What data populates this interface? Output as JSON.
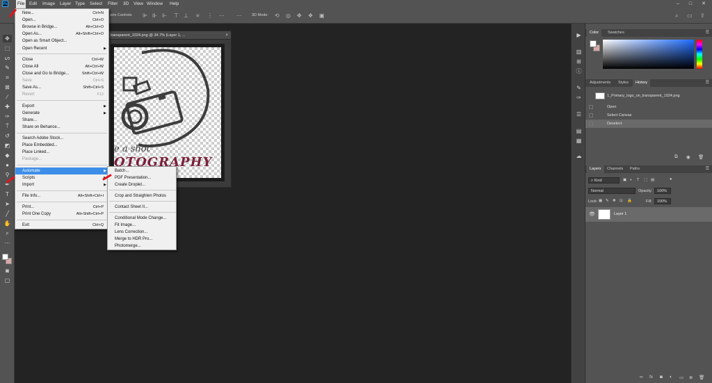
{
  "menubar": {
    "logo": "Ps",
    "items": [
      "File",
      "Edit",
      "Image",
      "Layer",
      "Type",
      "Select",
      "Filter",
      "3D",
      "View",
      "Window",
      "Help"
    ],
    "window_controls": [
      "–",
      "□",
      "✕"
    ]
  },
  "options_bar": {
    "transform_controls_label": "orm Controls",
    "mode_3d_label": "3D Mode:"
  },
  "document": {
    "tab_title": "transparent_1024.png @ 34.7% (Layer 1, ...",
    "close": "×",
    "logo_line1": "e a shot",
    "logo_line2": "OTOGRAPHY"
  },
  "file_menu": {
    "items": [
      {
        "label": "New...",
        "shortcut": "Ctrl+N"
      },
      {
        "label": "Open...",
        "shortcut": "Ctrl+O"
      },
      {
        "label": "Browse in Bridge...",
        "shortcut": "Alt+Ctrl+O"
      },
      {
        "label": "Open As...",
        "shortcut": "Alt+Shift+Ctrl+O"
      },
      {
        "label": "Open as Smart Object...",
        "shortcut": ""
      },
      {
        "label": "Open Recent",
        "shortcut": ""
      },
      {
        "label": "Close",
        "shortcut": "Ctrl+W"
      },
      {
        "label": "Close All",
        "shortcut": "Alt+Ctrl+W"
      },
      {
        "label": "Close and Go to Bridge...",
        "shortcut": "Shift+Ctrl+W"
      },
      {
        "label": "Save",
        "shortcut": "Ctrl+S"
      },
      {
        "label": "Save As...",
        "shortcut": "Shift+Ctrl+S"
      },
      {
        "label": "Revert",
        "shortcut": "F12"
      },
      {
        "label": "Export",
        "shortcut": ""
      },
      {
        "label": "Generate",
        "shortcut": ""
      },
      {
        "label": "Share...",
        "shortcut": ""
      },
      {
        "label": "Share on Behance...",
        "shortcut": ""
      },
      {
        "label": "Search Adobe Stock...",
        "shortcut": ""
      },
      {
        "label": "Place Embedded...",
        "shortcut": ""
      },
      {
        "label": "Place Linked...",
        "shortcut": ""
      },
      {
        "label": "Package...",
        "shortcut": ""
      },
      {
        "label": "Automate",
        "shortcut": ""
      },
      {
        "label": "Scripts",
        "shortcut": ""
      },
      {
        "label": "Import",
        "shortcut": ""
      },
      {
        "label": "File Info...",
        "shortcut": "Alt+Shift+Ctrl+I"
      },
      {
        "label": "Print...",
        "shortcut": "Ctrl+P"
      },
      {
        "label": "Print One Copy",
        "shortcut": "Alt+Shift+Ctrl+P"
      },
      {
        "label": "Exit",
        "shortcut": "Ctrl+Q"
      }
    ],
    "submenu_arrow": "▶"
  },
  "automate_menu": {
    "items": [
      "Batch...",
      "PDF Presentation...",
      "Create Droplet...",
      "Crop and Straighten Photos",
      "Contact Sheet II...",
      "Conditional Mode Change...",
      "Fit Image...",
      "Lens Correction...",
      "Merge to HDR Pro...",
      "Photomerge..."
    ]
  },
  "color_panel": {
    "tabs": [
      "Color",
      "Swatches"
    ],
    "fg_color": "#ffffff",
    "bg_color": "#d9a7a7"
  },
  "history_panel": {
    "tabs": [
      "Adjustments",
      "Styles",
      "History"
    ],
    "snapshot": "1_Primary_logo_on_transparent_1024.png",
    "states": [
      "Open",
      "Select Canvas",
      "Deselect"
    ]
  },
  "layers_panel": {
    "tabs": [
      "Layers",
      "Channels",
      "Paths"
    ],
    "filter_kind": "Kind",
    "blend_mode": "Normal",
    "opacity_label": "Opacity:",
    "opacity_value": "100%",
    "lock_label": "Lock:",
    "fill_label": "Fill:",
    "fill_value": "100%",
    "layer_name": "Layer 1"
  },
  "colors": {
    "highlight": "#3d8ee8",
    "menubar": "#535353",
    "workspace": "#232323",
    "annotation_arrow": "#e0141e"
  }
}
